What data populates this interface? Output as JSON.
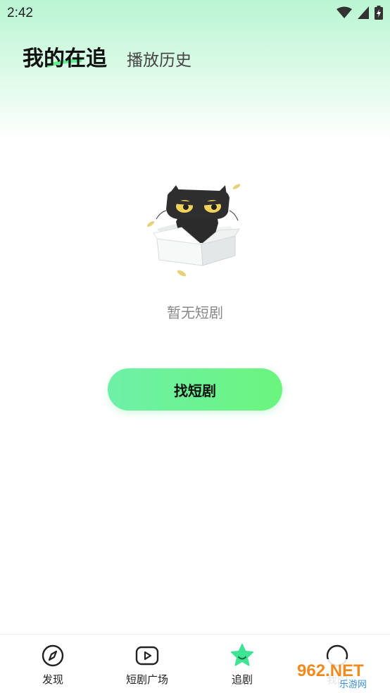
{
  "status_bar": {
    "time": "2:42",
    "icons": [
      "wifi-icon",
      "signal-icon",
      "battery-charging-icon"
    ]
  },
  "tabs": [
    {
      "label": "我的在追",
      "active": true
    },
    {
      "label": "播放历史",
      "active": false
    }
  ],
  "empty_state": {
    "illustration": "cat-in-box",
    "message": "暂无短剧",
    "button_label": "找短剧"
  },
  "bottom_nav": {
    "items": [
      {
        "label": "发现",
        "icon": "compass-icon"
      },
      {
        "label": "短剧广场",
        "icon": "play-box-icon"
      },
      {
        "label": "追剧",
        "icon": "star-icon",
        "active": true
      },
      {
        "label": "我的",
        "icon": "profile-icon"
      }
    ]
  },
  "watermark": {
    "brand": "962.NET",
    "subtitle": "乐游网"
  },
  "colors": {
    "accent": "#5ef08f",
    "header_tint": "#b9f5d2",
    "active_nav": "#3fe394"
  }
}
